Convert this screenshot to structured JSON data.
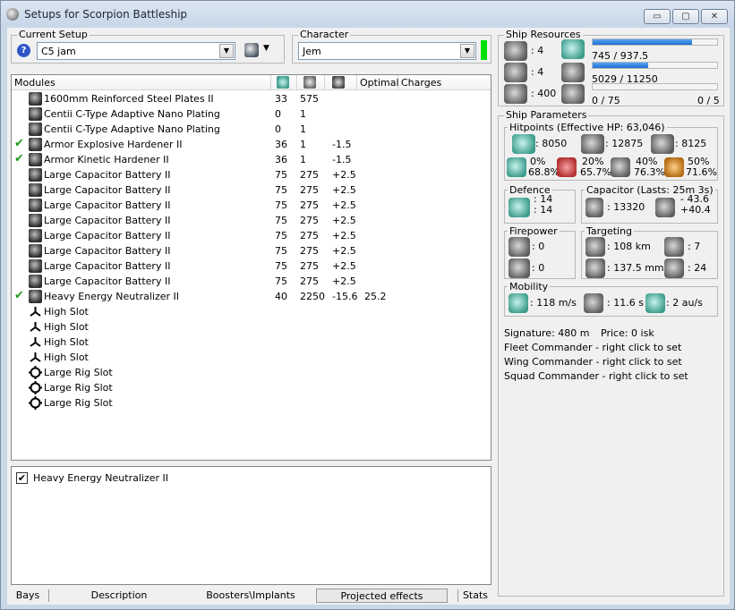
{
  "window": {
    "title": "Setups for Scorpion Battleship",
    "minimize_glyph": "▭",
    "restore_glyph": "▢",
    "close_glyph": "✕"
  },
  "current_setup": {
    "legend": "Current Setup",
    "value": "C5 jam"
  },
  "character": {
    "legend": "Character",
    "value": "Jem",
    "status_color": "#00e000"
  },
  "modules": {
    "headers": {
      "modules": "Modules",
      "optimal": "Optimal",
      "charges": "Charges"
    },
    "rows": [
      {
        "check": "",
        "name": "1600mm Reinforced Steel Plates II",
        "c1": "33",
        "c2": "575",
        "c3": "",
        "c4": ""
      },
      {
        "check": "",
        "name": "Centii C-Type Adaptive Nano Plating",
        "c1": "0",
        "c2": "1",
        "c3": "",
        "c4": ""
      },
      {
        "check": "",
        "name": "Centii C-Type Adaptive Nano Plating",
        "c1": "0",
        "c2": "1",
        "c3": "",
        "c4": ""
      },
      {
        "check": "✔",
        "name": "Armor Explosive Hardener II",
        "c1": "36",
        "c2": "1",
        "c3": "-1.5",
        "c4": ""
      },
      {
        "check": "✔",
        "name": "Armor Kinetic Hardener II",
        "c1": "36",
        "c2": "1",
        "c3": "-1.5",
        "c4": ""
      },
      {
        "check": "",
        "name": "Large Capacitor Battery II",
        "c1": "75",
        "c2": "275",
        "c3": "+2.5",
        "c4": ""
      },
      {
        "check": "",
        "name": "Large Capacitor Battery II",
        "c1": "75",
        "c2": "275",
        "c3": "+2.5",
        "c4": ""
      },
      {
        "check": "",
        "name": "Large Capacitor Battery II",
        "c1": "75",
        "c2": "275",
        "c3": "+2.5",
        "c4": ""
      },
      {
        "check": "",
        "name": "Large Capacitor Battery II",
        "c1": "75",
        "c2": "275",
        "c3": "+2.5",
        "c4": ""
      },
      {
        "check": "",
        "name": "Large Capacitor Battery II",
        "c1": "75",
        "c2": "275",
        "c3": "+2.5",
        "c4": ""
      },
      {
        "check": "",
        "name": "Large Capacitor Battery II",
        "c1": "75",
        "c2": "275",
        "c3": "+2.5",
        "c4": ""
      },
      {
        "check": "",
        "name": "Large Capacitor Battery II",
        "c1": "75",
        "c2": "275",
        "c3": "+2.5",
        "c4": ""
      },
      {
        "check": "",
        "name": "Large Capacitor Battery II",
        "c1": "75",
        "c2": "275",
        "c3": "+2.5",
        "c4": ""
      },
      {
        "check": "✔",
        "name": "Heavy Energy Neutralizer II",
        "c1": "40",
        "c2": "2250",
        "c3": "-15.6",
        "c4": "25.2"
      },
      {
        "check": "",
        "name": "High Slot",
        "c1": "",
        "c2": "",
        "c3": "",
        "c4": ""
      },
      {
        "check": "",
        "name": "High Slot",
        "c1": "",
        "c2": "",
        "c3": "",
        "c4": ""
      },
      {
        "check": "",
        "name": "High Slot",
        "c1": "",
        "c2": "",
        "c3": "",
        "c4": ""
      },
      {
        "check": "",
        "name": "High Slot",
        "c1": "",
        "c2": "",
        "c3": "",
        "c4": ""
      },
      {
        "check": "",
        "name": "Large Rig Slot",
        "c1": "",
        "c2": "",
        "c3": "",
        "c4": ""
      },
      {
        "check": "",
        "name": "Large Rig Slot",
        "c1": "",
        "c2": "",
        "c3": "",
        "c4": ""
      },
      {
        "check": "",
        "name": "Large Rig Slot",
        "c1": "",
        "c2": "",
        "c3": "",
        "c4": ""
      }
    ]
  },
  "detail": {
    "check": "✔",
    "label": "Heavy Energy Neutralizer II"
  },
  "tabs": [
    "Bays",
    "Description",
    "Boosters\\Implants",
    "Projected effects",
    "Stats"
  ],
  "resources": {
    "legend": "Ship Resources",
    "turret_hardpoints": ": 4",
    "launcher_hardpoints": ": 4",
    "drone_bay": ": 400",
    "cpu": "745 / 937.5",
    "cpu_fraction": 0.795,
    "powergrid": "5029 / 11250",
    "powergrid_fraction": 0.447,
    "calibration": "0 / 75",
    "calibration_fraction": 0,
    "rigs": "0 / 5"
  },
  "params": {
    "legend": "Ship Parameters",
    "hitpoints": {
      "legend": "Hitpoints (Effective HP: 63,046)",
      "shield": ": 8050",
      "armor": ": 12875",
      "structure": ": 8125",
      "resists": [
        {
          "a": "0%",
          "b": "68.8%"
        },
        {
          "a": "20%",
          "b": "65.7%"
        },
        {
          "a": "40%",
          "b": "76.3%"
        },
        {
          "a": "50%",
          "b": "71.6%"
        }
      ]
    },
    "defence": {
      "legend": "Defence",
      "a": ": 14",
      "b": ": 14"
    },
    "capacitor": {
      "legend": "Capacitor (Lasts: 25m 3s)",
      "amount": ": 13320",
      "a": "- 43.6",
      "b": "+40.4"
    },
    "firepower": {
      "legend": "Firepower",
      "a": ": 0",
      "b": ": 0"
    },
    "targeting": {
      "legend": "Targeting",
      "range": ": 108 km",
      "targets": ": 7",
      "resolution": ": 137.5 mm",
      "scan": ": 24"
    },
    "mobility": {
      "legend": "Mobility",
      "speed": ": 118 m/s",
      "align": ": 11.6 s",
      "warp": ": 2 au/s"
    },
    "signature": "Signature: 480 m",
    "price": "Price: 0 isk",
    "fleet": "Fleet Commander - right click to set",
    "wing": "Wing Commander - right click to set",
    "squad": "Squad Commander - right click to set"
  }
}
